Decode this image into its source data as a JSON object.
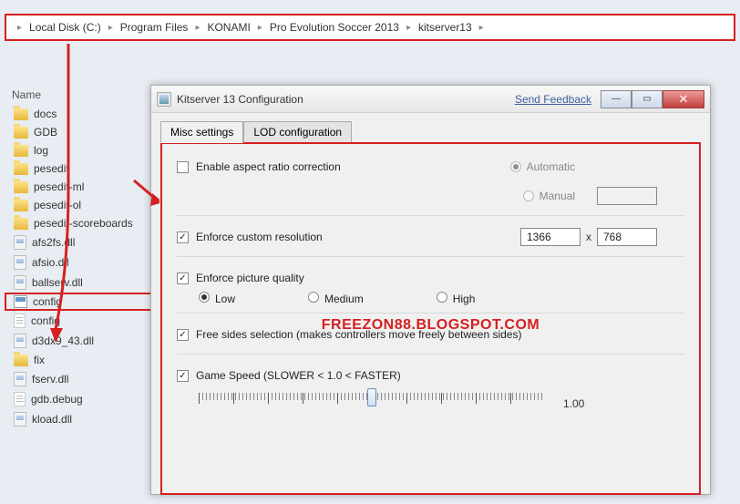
{
  "breadcrumb": [
    "Local Disk (C:)",
    "Program Files",
    "KONAMI",
    "Pro Evolution Soccer 2013",
    "kitserver13"
  ],
  "explorer": {
    "header": "Name",
    "items": [
      {
        "icon": "folder",
        "label": "docs"
      },
      {
        "icon": "folder",
        "label": "GDB"
      },
      {
        "icon": "folder",
        "label": "log"
      },
      {
        "icon": "folder",
        "label": "pesedit"
      },
      {
        "icon": "folder",
        "label": "pesedit-ml"
      },
      {
        "icon": "folder",
        "label": "pesedit-ol"
      },
      {
        "icon": "folder",
        "label": "pesedit-scoreboards"
      },
      {
        "icon": "dll",
        "label": "afs2fs.dll"
      },
      {
        "icon": "dll",
        "label": "afsio.dll"
      },
      {
        "icon": "dll",
        "label": "ballserv.dll"
      },
      {
        "icon": "config",
        "label": "config",
        "highlight": true
      },
      {
        "icon": "txt",
        "label": "config"
      },
      {
        "icon": "dll",
        "label": "d3dx9_43.dll"
      },
      {
        "icon": "folder",
        "label": "fix"
      },
      {
        "icon": "dll",
        "label": "fserv.dll"
      },
      {
        "icon": "txt",
        "label": "gdb.debug"
      },
      {
        "icon": "dll",
        "label": "kload.dll"
      }
    ]
  },
  "dialog": {
    "title": "Kitserver 13 Configuration",
    "send_feedback": "Send Feedback",
    "tabs": {
      "misc": "Misc settings",
      "lod": "LOD configuration"
    },
    "options": {
      "aspect_label": "Enable aspect ratio correction",
      "aspect_checked": false,
      "aspect_auto": "Automatic",
      "aspect_manual": "Manual",
      "resolution_label": "Enforce custom resolution",
      "resolution_checked": true,
      "res_w": "1366",
      "res_h": "768",
      "times": "x",
      "quality_label": "Enforce picture quality",
      "quality_checked": true,
      "quality_low": "Low",
      "quality_medium": "Medium",
      "quality_high": "High",
      "sides_label": "Free sides selection  (makes controllers move freely between sides)",
      "sides_checked": true,
      "speed_label": "Game Speed (SLOWER < 1.0 < FASTER)",
      "speed_checked": true,
      "speed_value": "1.00"
    },
    "watermark": "FREEZON88.BLOGSPOT.COM"
  }
}
